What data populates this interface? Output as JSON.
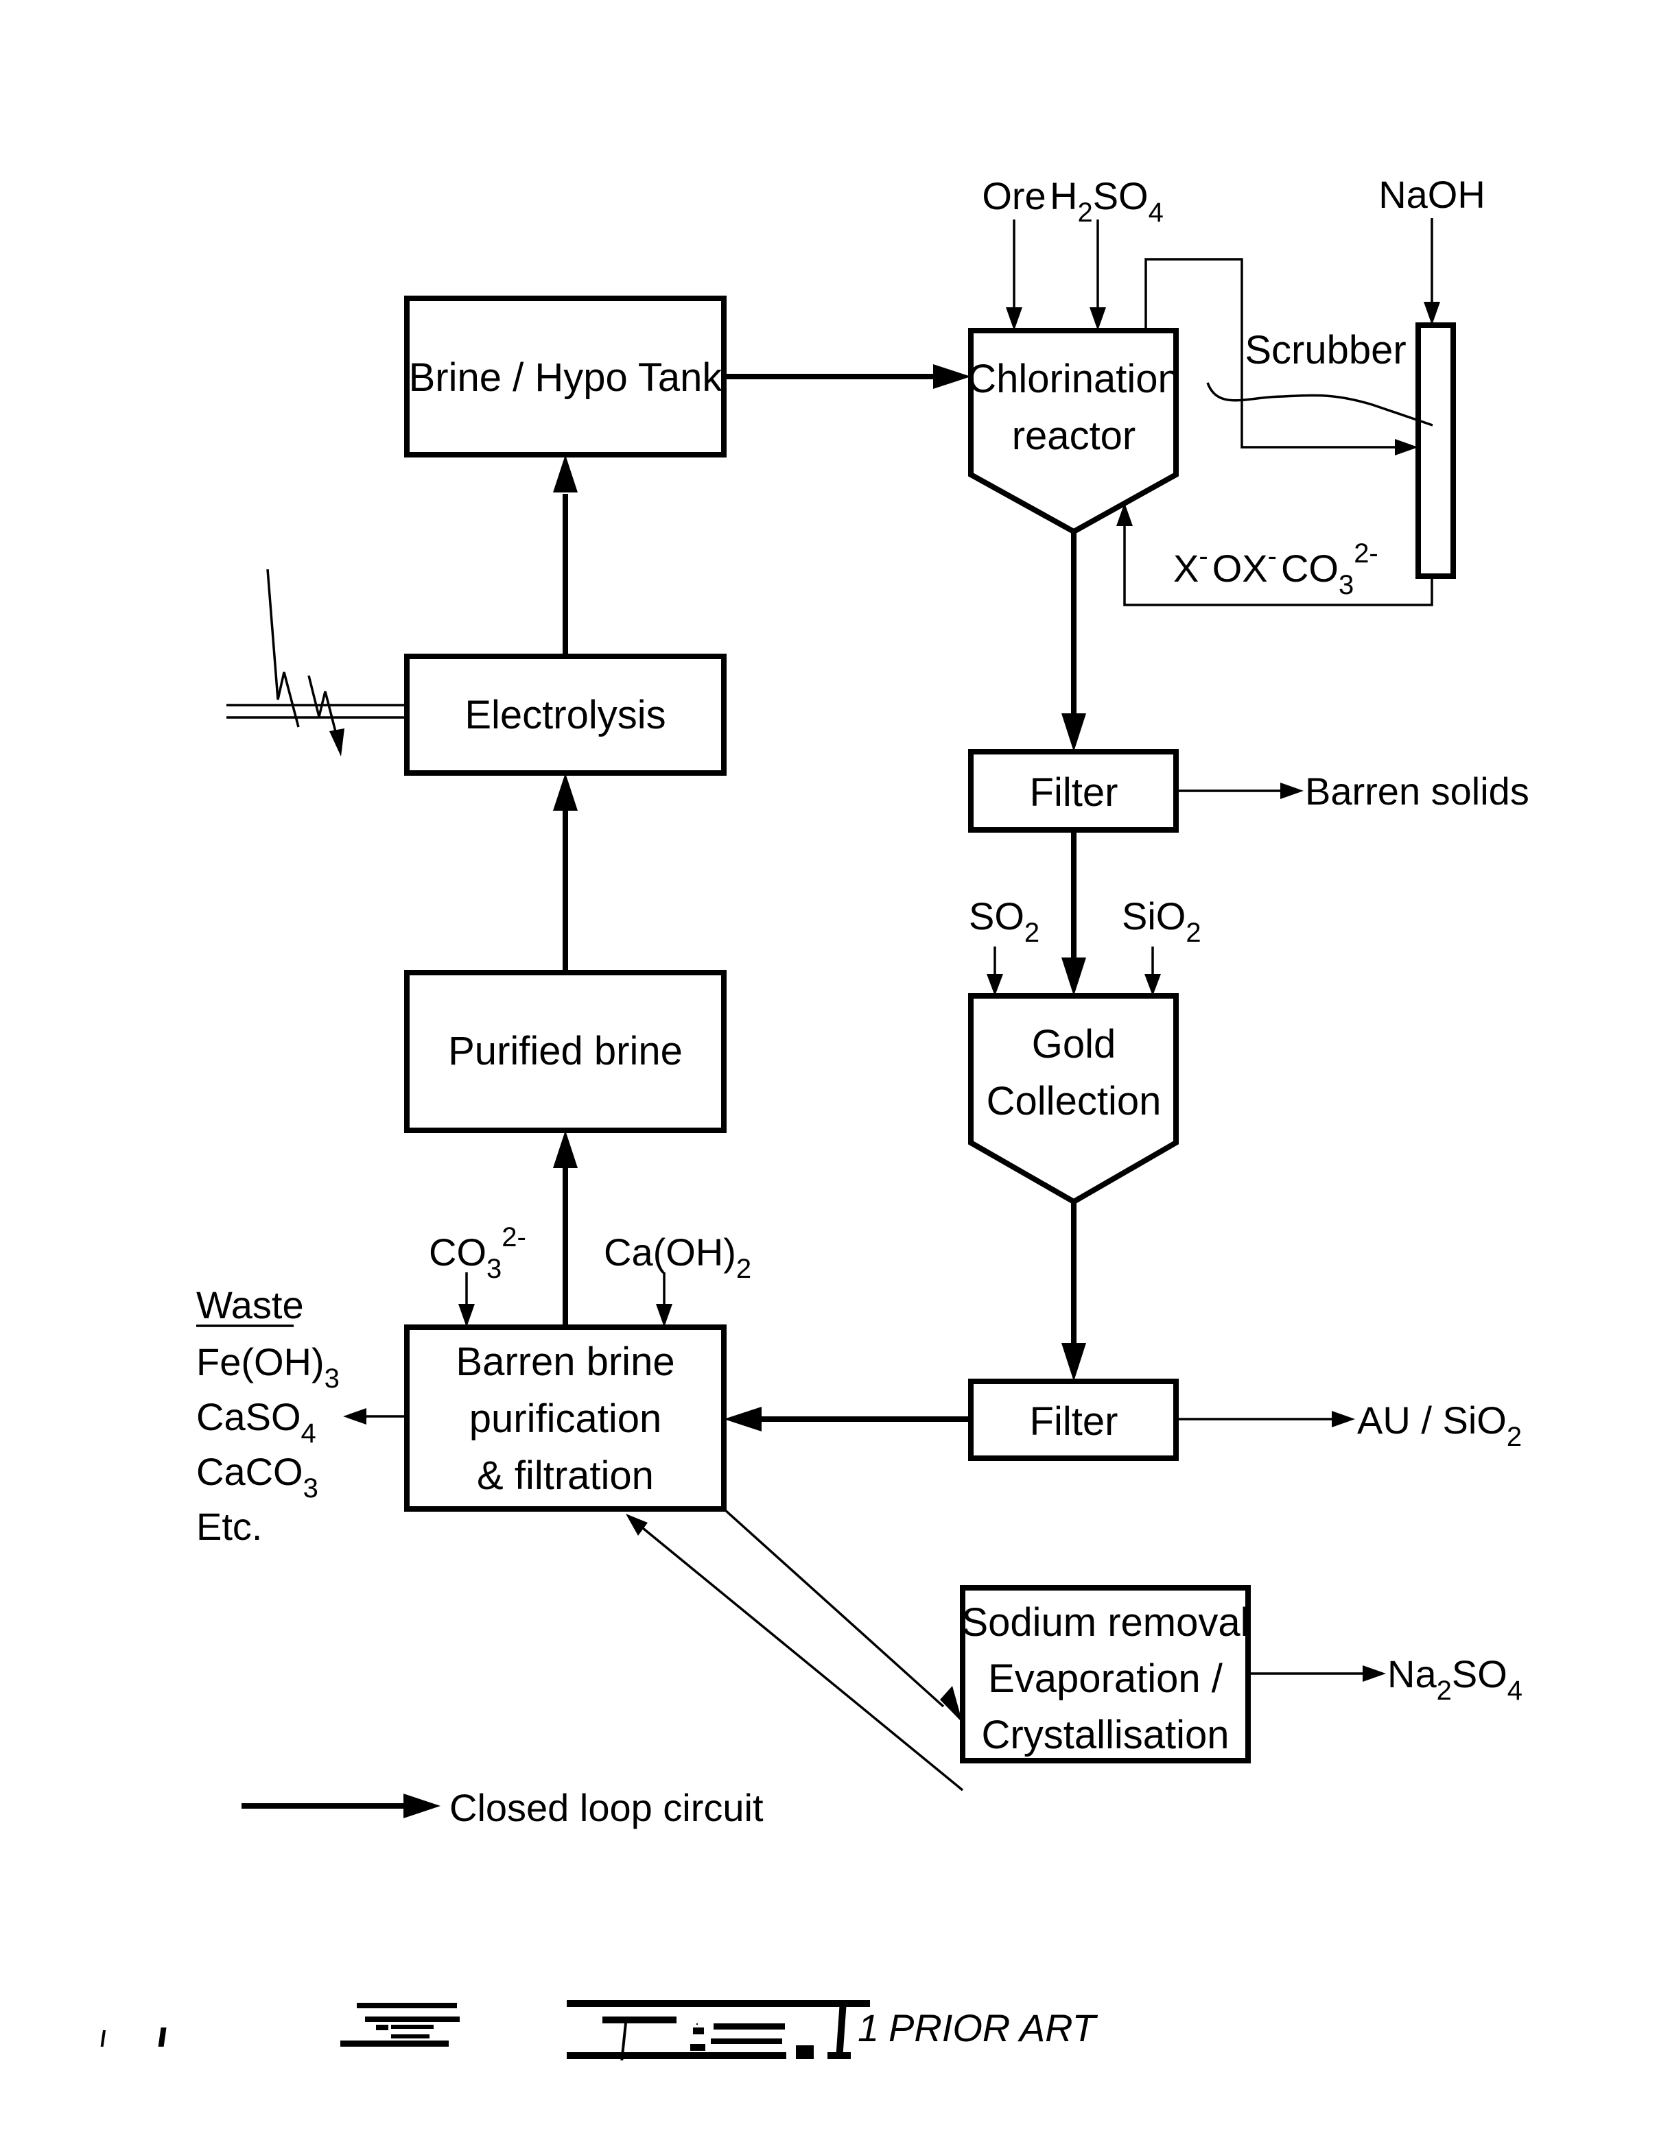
{
  "figure": {
    "title": "Fig. 1",
    "caption_number": "1",
    "caption_suffix": "PRIOR ART"
  },
  "process_units": {
    "brine_hypo_tank": "Brine / Hypo Tank",
    "electrolysis": "Electrolysis",
    "purified_brine": "Purified brine",
    "barren_brine": [
      "Barren brine",
      "purification",
      "& filtration"
    ],
    "chlorination_reactor": [
      "Chlorination",
      "reactor"
    ],
    "scrubber": "Scrubber",
    "filter_1": "Filter",
    "gold_collection": [
      "Gold",
      "Collection"
    ],
    "filter_2": "Filter",
    "sodium_removal": [
      "Sodium removal",
      "Evaporation /",
      "Crystallisation"
    ]
  },
  "inputs": {
    "ore": "Ore",
    "h2so4": {
      "base": "H",
      "sub1": "2",
      "mid": "SO",
      "sub2": "4"
    },
    "naoh": "NaOH",
    "so2": {
      "base": "SO",
      "sub": "2"
    },
    "sio2": {
      "base": "SiO",
      "sub": "2"
    },
    "co3": {
      "base": "CO",
      "sub": "3",
      "sup": "2-"
    },
    "caoh2": {
      "base": "Ca(OH)",
      "sub": "2"
    }
  },
  "streams": {
    "scrubber_return": {
      "x": "X",
      "x_sup": "-",
      "ox": "OX",
      "ox_sup": "-",
      "co": "CO",
      "co_sub": "3",
      "co_sup": "2-"
    },
    "barren_solids": "Barren solids",
    "au_sio2": {
      "base": "AU / SiO",
      "sub": "2"
    },
    "na2so4": {
      "na": "Na",
      "sub1": "2",
      "so": "SO",
      "sub2": "4"
    }
  },
  "waste": {
    "heading": "Waste",
    "items": [
      {
        "base": "Fe(OH)",
        "sub": "3"
      },
      {
        "base": "CaSO",
        "sub": "4"
      },
      {
        "base": "CaCO",
        "sub": "3"
      },
      {
        "base": "Etc.",
        "sub": ""
      }
    ]
  },
  "legend": {
    "closed_loop_label": "Closed loop circuit"
  }
}
